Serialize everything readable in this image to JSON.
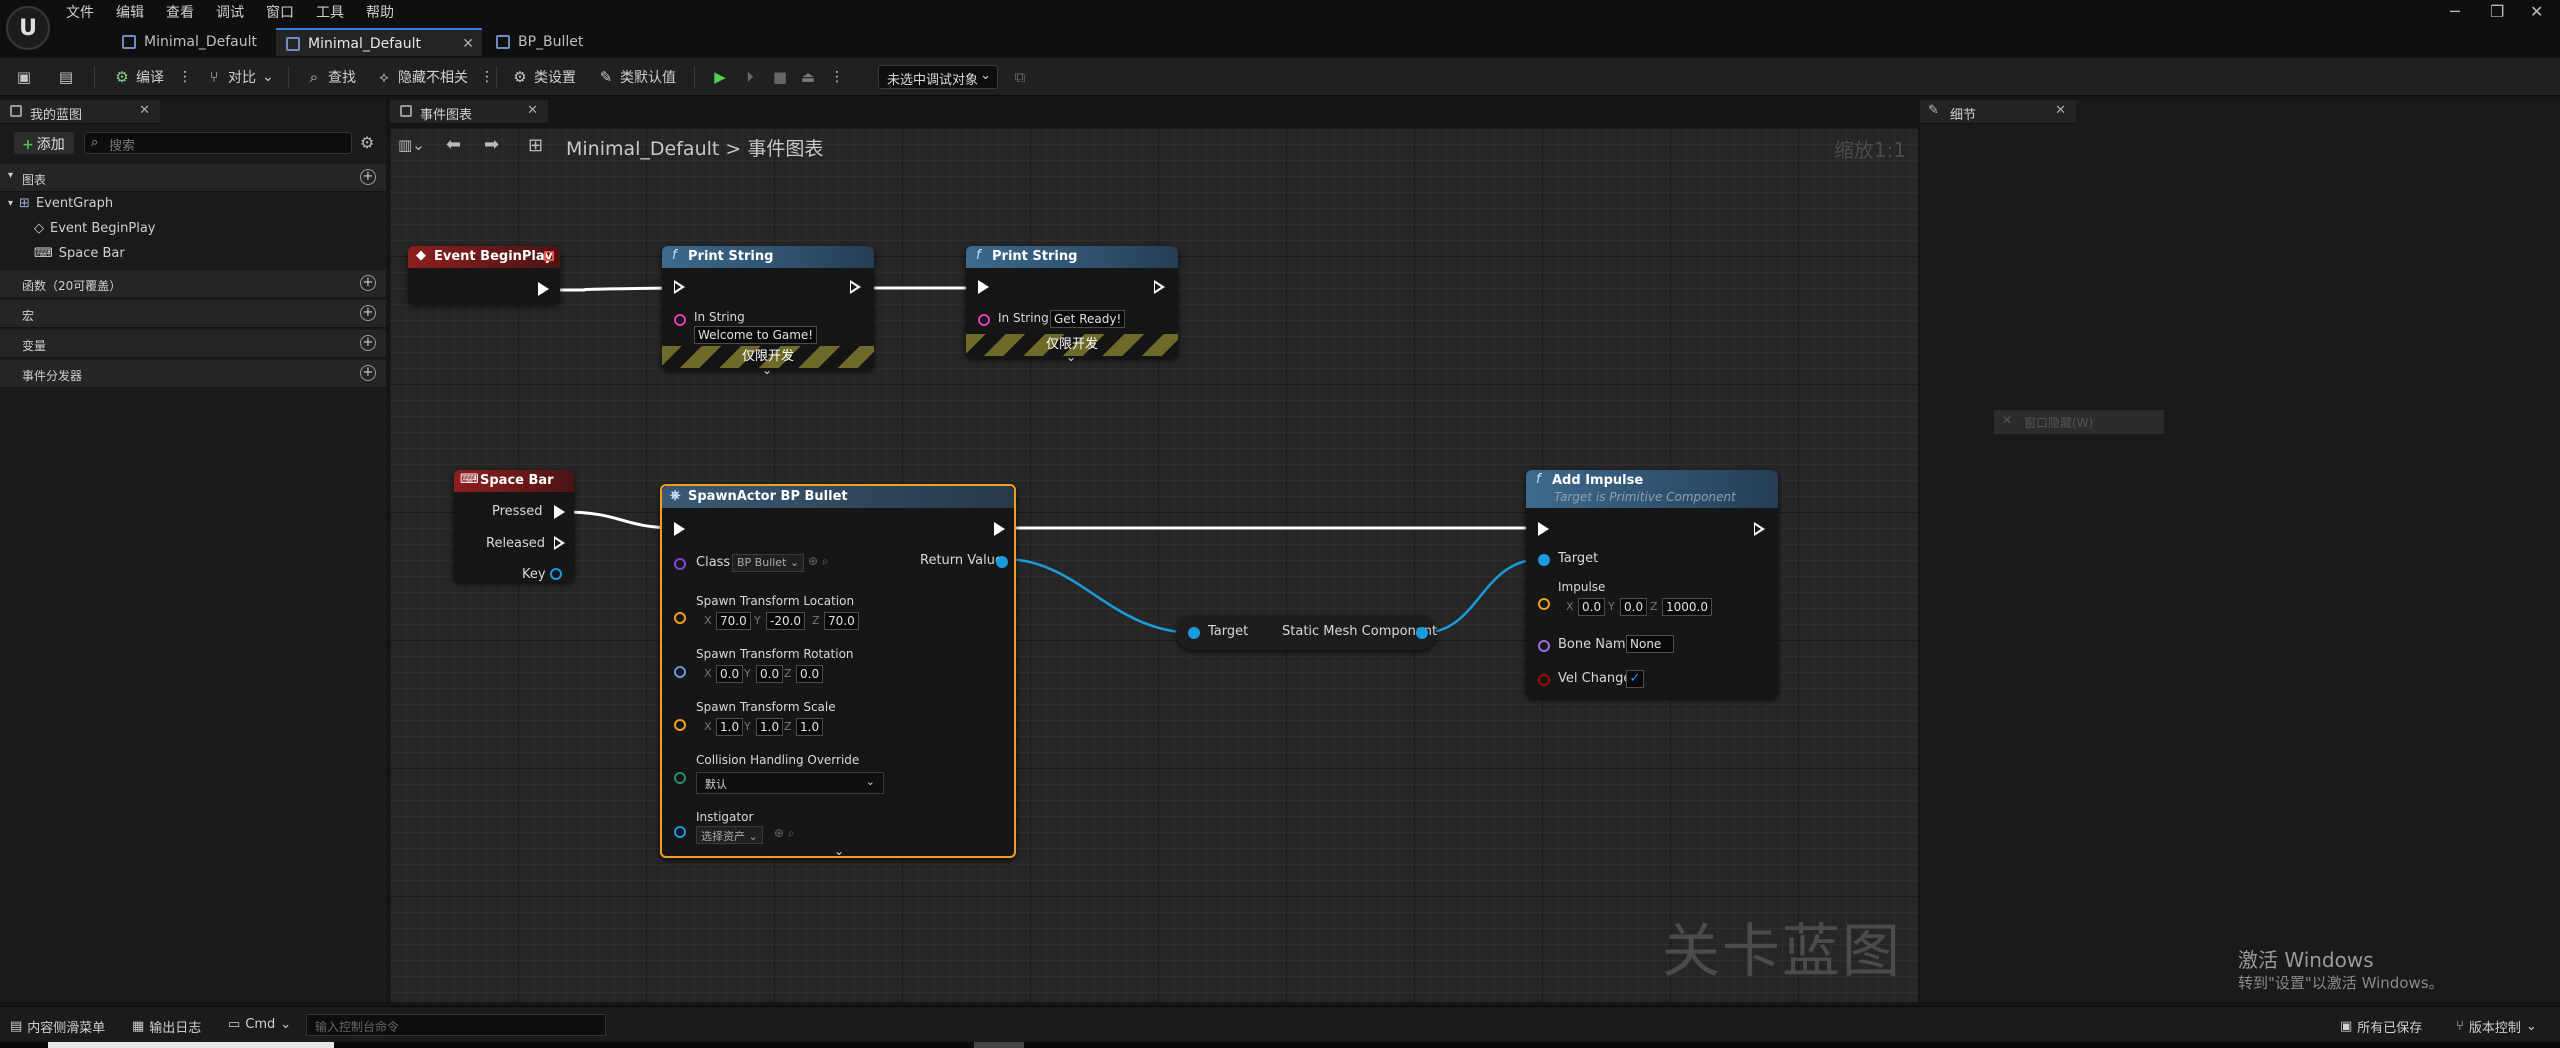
{
  "app": {
    "menu": [
      "文件",
      "编辑",
      "查看",
      "调试",
      "窗口",
      "工具",
      "帮助"
    ],
    "tabs": [
      {
        "label": "Minimal_Default",
        "active": false
      },
      {
        "label": "Minimal_Default",
        "active": true
      },
      {
        "label": "BP_Bullet",
        "active": false
      }
    ],
    "window_controls": [
      "minimize-icon",
      "restore-icon",
      "close-icon"
    ]
  },
  "toolbar": {
    "compile": "编译",
    "diff": "对比",
    "find": "查找",
    "hide_unrelated": "隐藏不相关",
    "class_settings": "类设置",
    "class_defaults": "类默认值",
    "debug_object": "未选中调试对象"
  },
  "my_blueprint": {
    "title": "我的蓝图",
    "add_label": "添加",
    "search_placeholder": "搜索",
    "graphs_label": "图表",
    "event_graph": "EventGraph",
    "graph_items": [
      "Event BeginPlay",
      "Space Bar"
    ],
    "functions_label": "函数（20可覆盖）",
    "macros_label": "宏",
    "variables_label": "变量",
    "dispatchers_label": "事件分发器"
  },
  "event_graph_panel": {
    "title": "事件图表",
    "breadcrumb_root": "Minimal_Default",
    "breadcrumb_sep": ">",
    "breadcrumb_current": "事件图表",
    "zoom": "缩放1:1",
    "watermark": "关卡蓝图"
  },
  "nodes": {
    "begin_play": {
      "title": "Event BeginPlay"
    },
    "print1": {
      "title": "Print String",
      "in_string_label": "In String",
      "in_string_value": "Welcome to Game!",
      "dev_only": "仅限开发"
    },
    "print2": {
      "title": "Print String",
      "in_string_label": "In String",
      "in_string_value": "Get Ready!",
      "dev_only": "仅限开发"
    },
    "space_bar": {
      "title": "Space Bar",
      "pressed": "Pressed",
      "released": "Released",
      "key": "Key"
    },
    "spawn": {
      "title": "SpawnActor BP Bullet",
      "class_label": "Class",
      "class_value": "BP Bullet",
      "return_value": "Return Value",
      "location_label": "Spawn Transform Location",
      "location": {
        "x": "70.0",
        "y": "-20.0",
        "z": "70.0"
      },
      "rotation_label": "Spawn Transform Rotation",
      "rotation": {
        "x": "0.0",
        "y": "0.0",
        "z": "0.0"
      },
      "scale_label": "Spawn Transform Scale",
      "scale": {
        "x": "1.0",
        "y": "1.0",
        "z": "1.0"
      },
      "collision_label": "Collision Handling Override",
      "collision_value": "默认",
      "instigator_label": "Instigator",
      "instigator_value": "选择资产"
    },
    "getter": {
      "target": "Target",
      "output": "Static Mesh Component"
    },
    "impulse": {
      "title": "Add Impulse",
      "subtitle": "Target is Primitive Component",
      "target": "Target",
      "impulse_label": "Impulse",
      "impulse": {
        "x": "0.0",
        "y": "0.0",
        "z": "1000.0"
      },
      "bone_label": "Bone Name",
      "bone_value": "None",
      "vel_label": "Vel Change",
      "vel_change": true
    }
  },
  "details": {
    "title": "细节",
    "ghost_button": "窗口隐藏(W)"
  },
  "activation": {
    "line1": "激活 Windows",
    "line2": "转到\"设置\"以激活 Windows。"
  },
  "statusbar": {
    "content_drawer": "内容侧滑菜单",
    "output_log": "输出日志",
    "cmd": "Cmd",
    "console_placeholder": "输入控制台命令",
    "all_saved": "所有已保存",
    "source_control": "版本控制"
  },
  "colors": {
    "accent": "#2f7fe0",
    "event_header": "#8e1f1f",
    "function_header": "#3d6a8e",
    "selection": "#f0a020",
    "exec_wire": "#ffffff",
    "object_wire": "#1a9bdc"
  }
}
